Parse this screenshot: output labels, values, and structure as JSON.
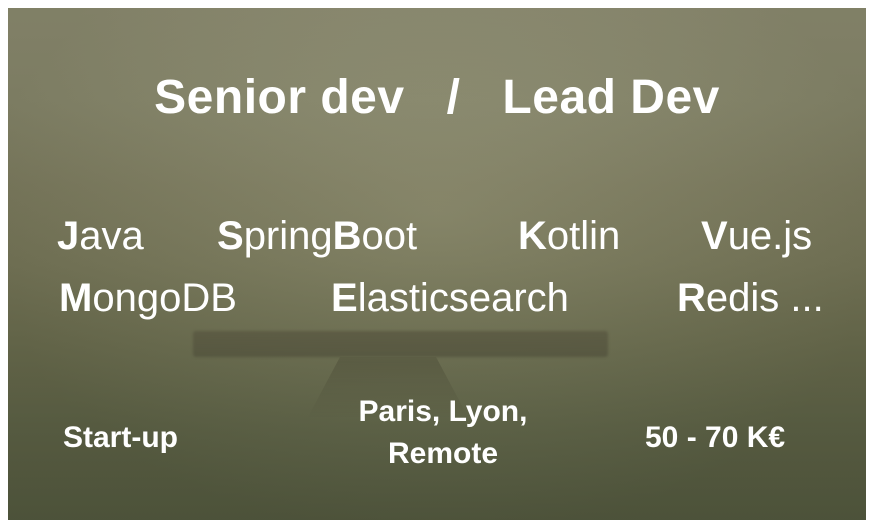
{
  "headline": {
    "left": "Senior dev",
    "separator": "/",
    "right": "Lead Dev"
  },
  "technologies": [
    {
      "initial": "J",
      "rest": "ava"
    },
    {
      "initial": "S",
      "rest": "pring"
    },
    {
      "initial": "B",
      "rest": "oot"
    },
    {
      "initial": "K",
      "rest": "otlin"
    },
    {
      "initial": "V",
      "rest": "ue.js"
    },
    {
      "initial": "M",
      "rest": "ongoDB"
    },
    {
      "initial": "E",
      "rest": "lasticsearch"
    },
    {
      "initial": "R",
      "rest": "edis ..."
    }
  ],
  "footer": {
    "company_type": "Start-up",
    "location_line1": "Paris, Lyon,",
    "location_line2": "Remote",
    "salary": "50 - 70 K€"
  },
  "colors": {
    "text": "#ffffff",
    "background_top": "#8f8e72",
    "background_bottom": "#555b40"
  }
}
